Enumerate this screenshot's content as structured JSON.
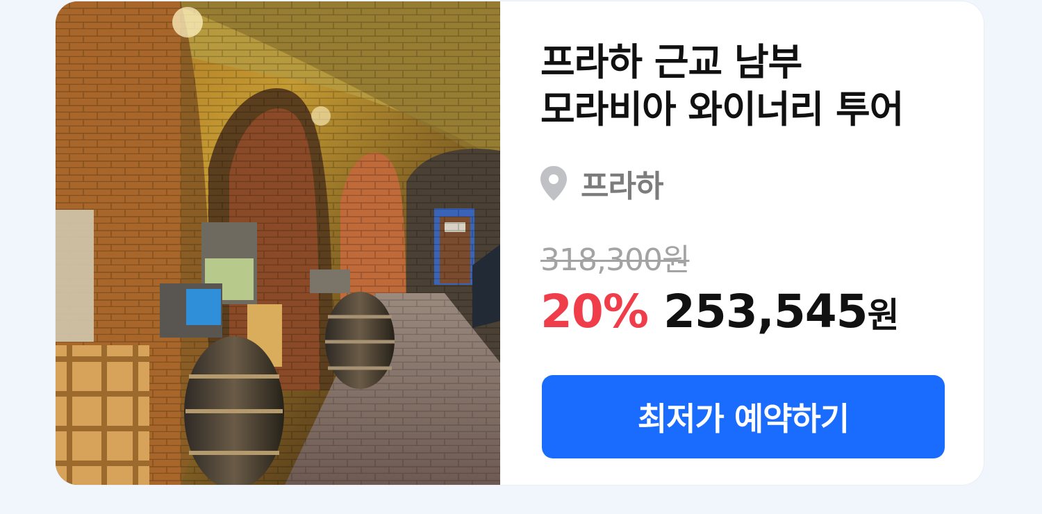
{
  "product": {
    "title_line1": "프라하 근교 남부",
    "title_line2": "모라비아 와이너리 투어",
    "location": "프라하",
    "location_icon": "map-pin-icon",
    "original_price": "318,300원",
    "discount": "20%",
    "sale_price": "253,545",
    "currency": "원",
    "cta_label": "최저가 예약하기",
    "image_icon": "wine-cellar-photo"
  },
  "colors": {
    "background": "#f1f6fd",
    "card": "#ffffff",
    "discount": "#ef3e4a",
    "cta": "#1a6cff",
    "muted": "#7c7c7c"
  }
}
